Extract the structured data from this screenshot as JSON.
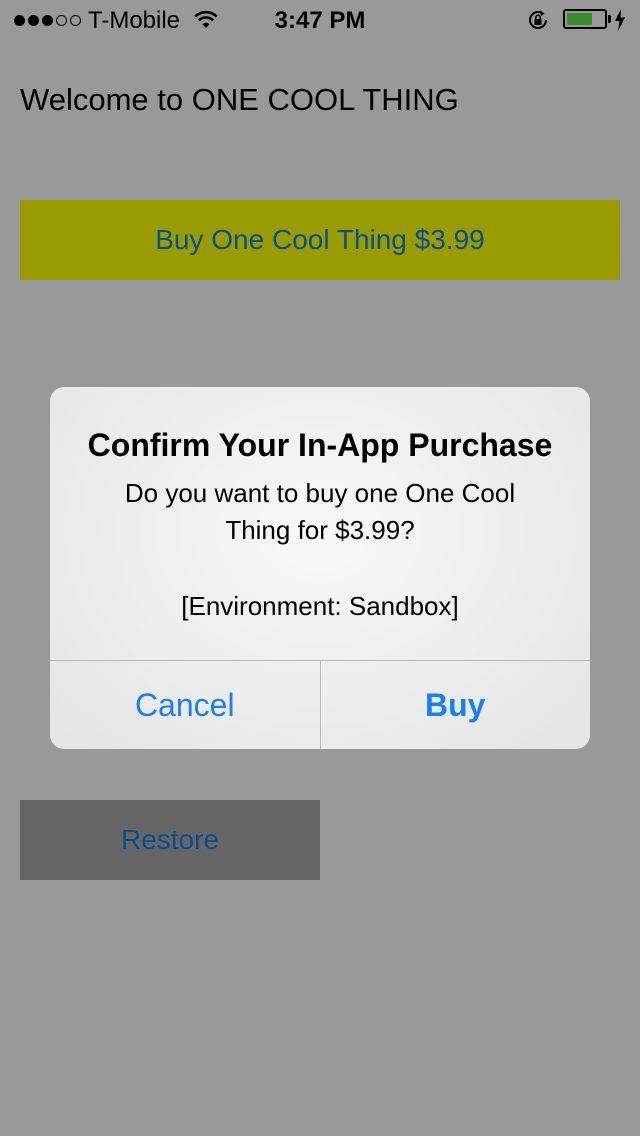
{
  "status_bar": {
    "signal_bars": [
      "filled",
      "filled",
      "filled",
      "empty",
      "empty"
    ],
    "carrier": "T-Mobile",
    "time": "3:47 PM",
    "battery_level": 0.7,
    "battery_color": "#3c8a2e",
    "wifi_icon": "wifi-icon",
    "lock_icon": "rotation-lock-icon",
    "charging_icon": "bolt-icon"
  },
  "app": {
    "welcome_text": "Welcome to ONE COOL THING",
    "buy_button_label": "Buy One Cool Thing $3.99",
    "restore_button_label": "Restore"
  },
  "alert": {
    "title": "Confirm Your In-App Purchase",
    "message": "Do you want to buy one One Cool Thing for $3.99?",
    "environment": "[Environment: Sandbox]",
    "cancel_label": "Cancel",
    "buy_label": "Buy"
  },
  "colors": {
    "background": "#999999",
    "buy_button_bg": "#989c00",
    "restore_button_bg": "#666666",
    "button_text": "#0a4f8c",
    "alert_button_text": "#1a7ff0"
  }
}
